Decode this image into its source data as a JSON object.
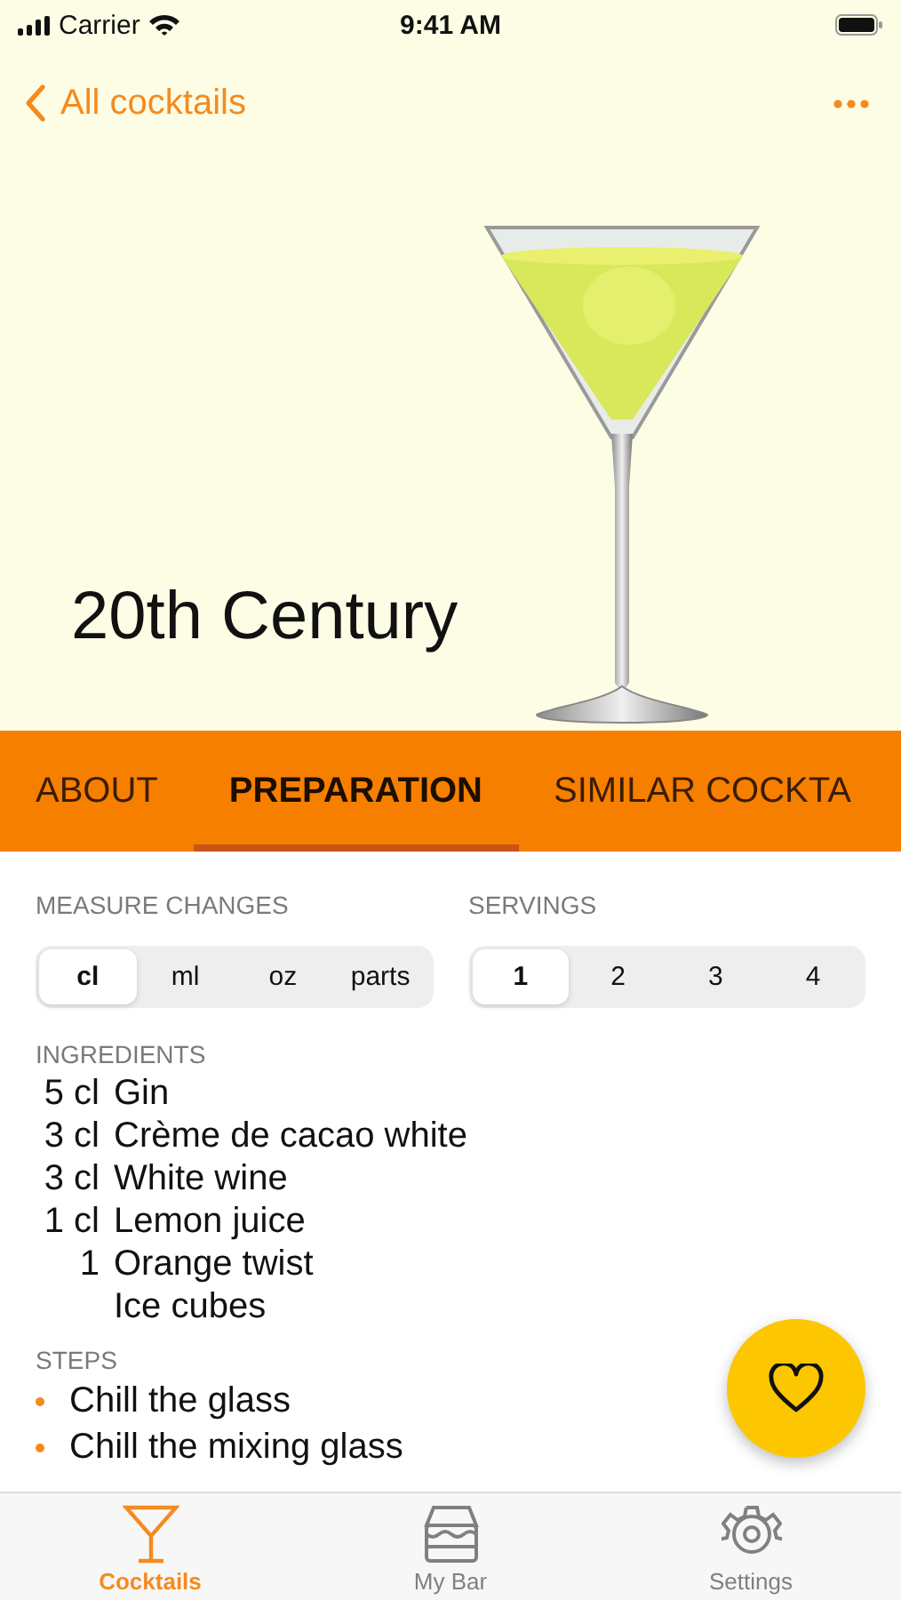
{
  "status_bar": {
    "carrier": "Carrier",
    "time": "9:41 AM"
  },
  "nav": {
    "back_label": "All cocktails"
  },
  "hero": {
    "title": "20th Century"
  },
  "tabs": [
    {
      "label": "ABOUT",
      "selected": false
    },
    {
      "label": "PREPARATION",
      "selected": true
    },
    {
      "label": "SIMILAR COCKTA",
      "selected": false
    }
  ],
  "measure": {
    "label": "MEASURE CHANGES",
    "options": [
      {
        "label": "cl",
        "selected": true
      },
      {
        "label": "ml",
        "selected": false
      },
      {
        "label": "oz",
        "selected": false
      },
      {
        "label": "parts",
        "selected": false
      }
    ]
  },
  "servings": {
    "label": "SERVINGS",
    "options": [
      {
        "label": "1",
        "selected": true
      },
      {
        "label": "2",
        "selected": false
      },
      {
        "label": "3",
        "selected": false
      },
      {
        "label": "4",
        "selected": false
      }
    ]
  },
  "ingredients": {
    "label": "INGREDIENTS",
    "items": [
      {
        "amount": "5 cl",
        "name": "Gin"
      },
      {
        "amount": "3 cl",
        "name": "Crème de cacao white"
      },
      {
        "amount": "3 cl",
        "name": "White wine"
      },
      {
        "amount": "1 cl",
        "name": "Lemon juice"
      },
      {
        "amount": "1",
        "name": "Orange twist"
      },
      {
        "name": "Ice cubes"
      }
    ]
  },
  "steps": {
    "label": "STEPS",
    "items": [
      "Chill the glass",
      "Chill the mixing glass"
    ]
  },
  "tab_bar": [
    {
      "kind": "glass",
      "label": "Cocktails",
      "selected": true
    },
    {
      "kind": "bar",
      "label": "My Bar",
      "selected": false
    },
    {
      "kind": "gear",
      "label": "Settings",
      "selected": false
    }
  ]
}
